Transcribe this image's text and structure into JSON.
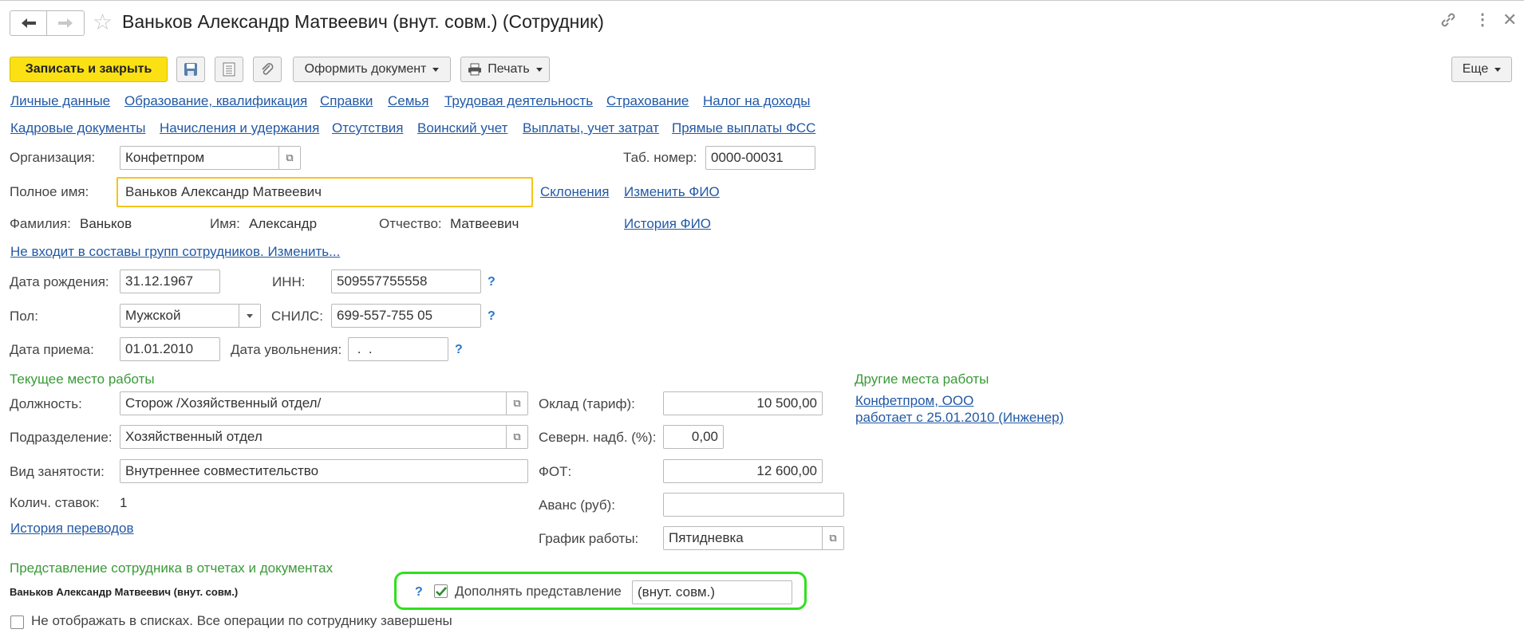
{
  "window": {
    "title": "Ваньков Александр Матвеевич (внут. совм.) (Сотрудник)"
  },
  "toolbar": {
    "save_close": "Записать и закрыть",
    "create_document": "Оформить документ",
    "print": "Печать",
    "more": "Еще"
  },
  "tabs_row1": [
    "Личные данные",
    "Образование, квалификация",
    "Справки",
    "Семья",
    "Трудовая деятельность",
    "Страхование",
    "Налог на доходы"
  ],
  "tabs_row2": [
    "Кадровые документы",
    "Начисления и удержания",
    "Отсутствия",
    "Воинский учет",
    "Выплаты, учет затрат",
    "Прямые выплаты ФСС"
  ],
  "form": {
    "org_label": "Организация:",
    "org_value": "Конфетпром",
    "tab_label": "Таб. номер:",
    "tab_value": "0000-00031",
    "fullname_label": "Полное имя:",
    "fullname_value": "Ваньков Александр Матвеевич",
    "declension_link": "Склонения",
    "change_fio_link": "Изменить ФИО",
    "surname_label": "Фамилия:",
    "surname_value": "Ваньков",
    "name_label": "Имя:",
    "name_value": "Александр",
    "patronymic_label": "Отчество:",
    "patronymic_value": "Матвеевич",
    "history_fio_link": "История ФИО",
    "groups_link": "Не входит в составы групп сотрудников. Изменить...",
    "birth_label": "Дата рождения:",
    "birth_value": "31.12.1967",
    "inn_label": "ИНН:",
    "inn_value": "509557755558",
    "gender_label": "Пол:",
    "gender_value": "Мужской",
    "snils_label": "СНИЛС:",
    "snils_value": "699-557-755 05",
    "hire_label": "Дата приема:",
    "hire_value": "01.01.2010",
    "fire_label": "Дата увольнения:",
    "fire_value": " .  .",
    "help": "?"
  },
  "current_work": {
    "section": "Текущее место работы",
    "position_label": "Должность:",
    "position_value": "Сторож /Хозяйственный отдел/",
    "dept_label": "Подразделение:",
    "dept_value": "Хозяйственный отдел",
    "emp_type_label": "Вид занятости:",
    "emp_type_value": "Внутреннее совместительство",
    "rates_label": "Колич. ставок:",
    "rates_value": "1",
    "transfer_history_link": "История переводов",
    "salary_label": "Оклад (тариф):",
    "salary_value": "10 500,00",
    "north_label": "Северн. надб. (%):",
    "north_value": "0,00",
    "fot_label": "ФОТ:",
    "fot_value": "12 600,00",
    "advance_label": "Аванс (руб):",
    "advance_value": "",
    "schedule_label": "График работы:",
    "schedule_value": "Пятидневка"
  },
  "other_work": {
    "section": "Другие места работы",
    "org_link": "Конфетпром, ООО",
    "since_link": "работает с 25.01.2010 (Инженер)"
  },
  "representation": {
    "section": "Представление сотрудника в отчетах и документах",
    "name_bold": "Ваньков Александр Матвеевич (внут. совм.)",
    "supplement_label": "Дополнять представление",
    "supplement_checked": true,
    "supplement_value": "(внут. совм.)",
    "hide_label": "Не отображать в списках. Все операции по сотруднику завершены",
    "hide_checked": false
  },
  "colors": {
    "accent_yellow": "#fbe114",
    "link_blue": "#2259a5",
    "section_green": "#3a9a38",
    "highlight_green": "#2ee01e"
  }
}
